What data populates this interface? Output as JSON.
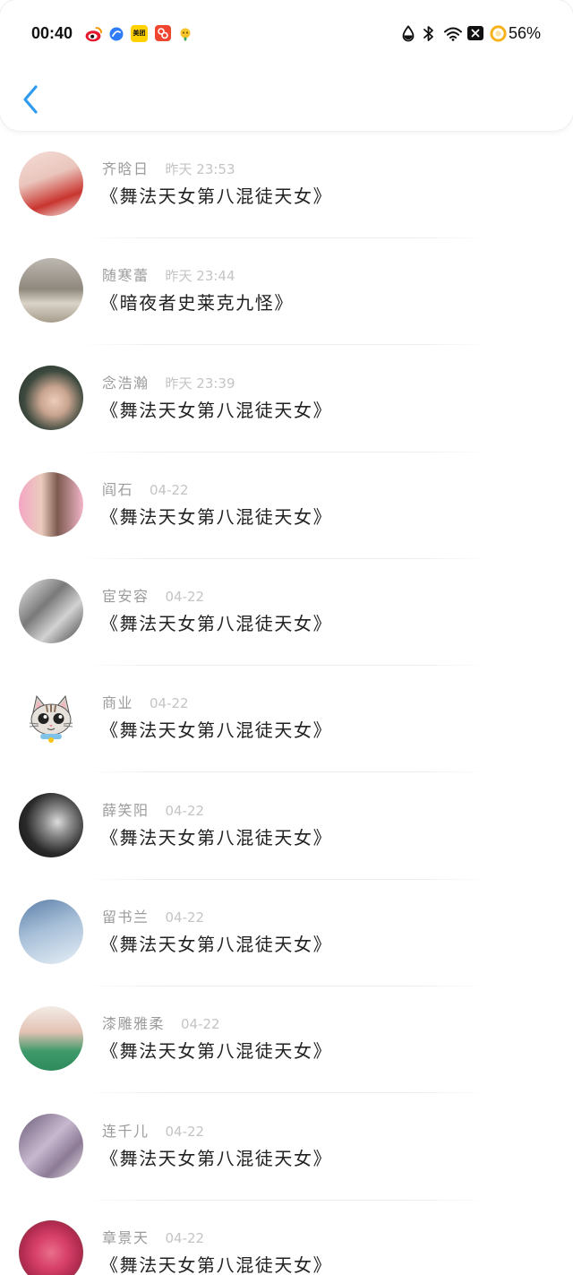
{
  "status_bar": {
    "time": "00:40",
    "notification_icons": [
      "weibo-icon",
      "blue-app-icon",
      "meituan-icon",
      "red-app-icon",
      "yellow-app-icon"
    ],
    "meituan_label": "美团",
    "system_icons": [
      "drop-icon",
      "bluetooth-icon",
      "wifi-icon",
      "close-box-icon",
      "battery-icon"
    ],
    "battery_level": "56%"
  },
  "header": {
    "back_icon": "chevron-left-icon",
    "accent_color": "#2e9bf0"
  },
  "messages": [
    {
      "name": "齐晗日",
      "time": "昨天 23:53",
      "text": "《舞法天女第八混徒天女》"
    },
    {
      "name": "随寒蕾",
      "time": "昨天 23:44",
      "text": "《暗夜者史莱克九怪》"
    },
    {
      "name": "念浩瀚",
      "time": "昨天 23:39",
      "text": "《舞法天女第八混徒天女》"
    },
    {
      "name": "阎石",
      "time": "04-22",
      "text": "《舞法天女第八混徒天女》"
    },
    {
      "name": "宦安容",
      "time": "04-22",
      "text": "《舞法天女第八混徒天女》"
    },
    {
      "name": "商业",
      "time": "04-22",
      "text": "《舞法天女第八混徒天女》"
    },
    {
      "name": "薛笑阳",
      "time": "04-22",
      "text": "《舞法天女第八混徒天女》"
    },
    {
      "name": "留书兰",
      "time": "04-22",
      "text": "《舞法天女第八混徒天女》"
    },
    {
      "name": "漆雕雅柔",
      "time": "04-22",
      "text": "《舞法天女第八混徒天女》"
    },
    {
      "name": "连千儿",
      "time": "04-22",
      "text": "《舞法天女第八混徒天女》"
    },
    {
      "name": "章景天",
      "time": "04-22",
      "text": "《舞法天女第八混徒天女》"
    }
  ]
}
